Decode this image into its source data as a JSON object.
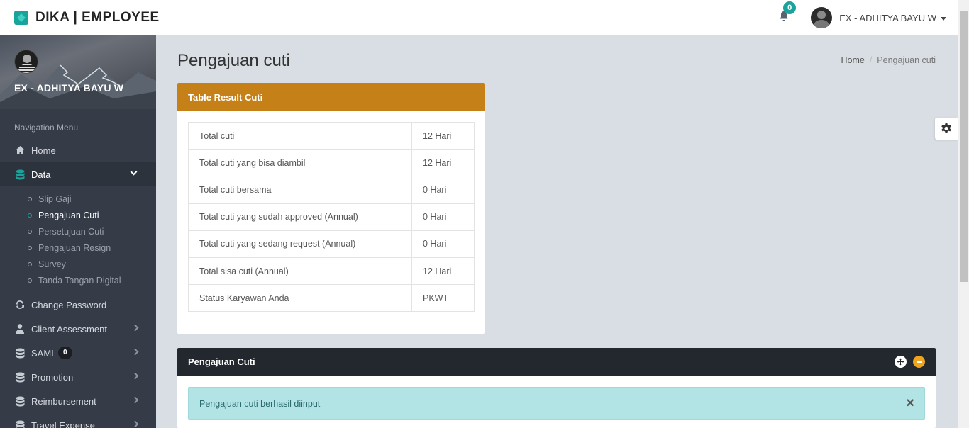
{
  "header": {
    "brand": "DIKA | EMPLOYEE",
    "notification_count": "0",
    "user_name": "EX - ADHITYA BAYU W"
  },
  "sidebar": {
    "profile_name": "EX - ADHITYA BAYU W",
    "nav_header": "Navigation Menu",
    "items": [
      {
        "label": "Home",
        "icon": "home-icon"
      },
      {
        "label": "Data",
        "icon": "database-icon",
        "active": true
      },
      {
        "label": "Change Password",
        "icon": "refresh-icon"
      },
      {
        "label": "Client Assessment",
        "icon": "user-icon"
      },
      {
        "label": "SAMI",
        "icon": "database-icon",
        "badge": "0"
      },
      {
        "label": "Promotion",
        "icon": "database-icon"
      },
      {
        "label": "Reimbursement",
        "icon": "database-icon"
      },
      {
        "label": "Travel Expense",
        "icon": "database-icon"
      }
    ],
    "submenu": [
      {
        "label": "Slip Gaji"
      },
      {
        "label": "Pengajuan Cuti",
        "current": true
      },
      {
        "label": "Persetujuan Cuti"
      },
      {
        "label": "Pengajuan Resign"
      },
      {
        "label": "Survey"
      },
      {
        "label": "Tanda Tangan Digital"
      }
    ]
  },
  "page": {
    "title": "Pengajuan cuti",
    "breadcrumb": {
      "home": "Home",
      "current": "Pengajuan cuti"
    }
  },
  "result_card": {
    "title": "Table Result Cuti",
    "rows": [
      {
        "label": "Total cuti",
        "value": "12 Hari"
      },
      {
        "label": "Total cuti yang bisa diambil",
        "value": "12 Hari"
      },
      {
        "label": "Total cuti bersama",
        "value": "0 Hari"
      },
      {
        "label": "Total cuti yang sudah approved (Annual)",
        "value": "0 Hari"
      },
      {
        "label": "Total cuti yang sedang request (Annual)",
        "value": "0 Hari"
      },
      {
        "label": "Total sisa cuti (Annual)",
        "value": "12 Hari"
      },
      {
        "label": "Status Karyawan Anda",
        "value": "PKWT"
      }
    ]
  },
  "form_card": {
    "title": "Pengajuan Cuti",
    "alert_text": "Pengajuan cuti berhasil diinput",
    "alert_close": "×"
  },
  "colors": {
    "accent": "#1aa39a",
    "result_header": "#c58117",
    "sidebar_bg": "#353c48",
    "alert_bg": "#b2e3e5"
  }
}
